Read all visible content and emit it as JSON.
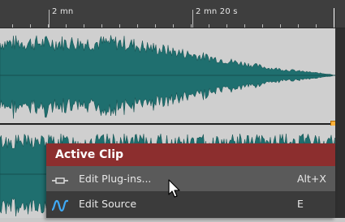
{
  "ruler": {
    "labels": [
      "2 mn",
      "2 mn 20 s"
    ]
  },
  "context_menu": {
    "title": "Active Clip",
    "items": [
      {
        "label": "Edit Plug-ins...",
        "shortcut": "Alt+X",
        "icon": "plugin-icon",
        "highlighted": true
      },
      {
        "label": "Edit Source",
        "shortcut": "E",
        "icon": "waveform-icon",
        "highlighted": false
      }
    ]
  },
  "colors": {
    "waveform": "#1f6f6f",
    "track_background": "#cfcfcf",
    "menu_header": "#8c2e2e",
    "menu_background": "#3b3b3b",
    "menu_highlight": "#5a5a5a",
    "handle": "#ffb23a"
  }
}
